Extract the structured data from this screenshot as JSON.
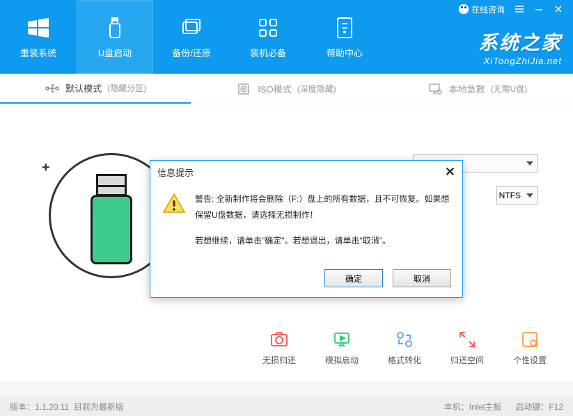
{
  "titlebar": {
    "consult": "在线咨询"
  },
  "nav": {
    "items": [
      {
        "label": "重装系统"
      },
      {
        "label": "U盘启动"
      },
      {
        "label": "备份/还原"
      },
      {
        "label": "装机必备"
      },
      {
        "label": "帮助中心"
      }
    ]
  },
  "brand": {
    "main": "系统之家",
    "sub": "XiTongZhiJia.net"
  },
  "modes": {
    "items": [
      {
        "label": "默认模式",
        "sub": "(隐藏分区)"
      },
      {
        "label": "ISO模式",
        "sub": "(深度隐藏)"
      },
      {
        "label": "本地急救",
        "sub": "(无需U盘)"
      }
    ]
  },
  "fields": {
    "filesystem": "NTFS"
  },
  "tools": {
    "items": [
      {
        "label": "无损归还",
        "color": "#ff4c4c"
      },
      {
        "label": "模拟启动",
        "color": "#2ecc71"
      },
      {
        "label": "格式转化",
        "color": "#4a9eff"
      },
      {
        "label": "归还空间",
        "color": "#ff4c4c"
      },
      {
        "label": "个性设置",
        "color": "#ff9a3c"
      }
    ]
  },
  "status": {
    "version_label": "版本：",
    "version": "1.1.20.11",
    "latest": "目前为最新版",
    "host_label": "本机：",
    "host": "Intel主板",
    "bootkey_label": "启动键：",
    "bootkey": "F12"
  },
  "dialog": {
    "title": "信息提示",
    "warn_line1": "警告: 全新制作将会删除（F:）盘上的所有数据，且不可恢复。如果想保留U盘数据，请选择无损制作！",
    "warn_line2": "若想继续，请单击\"确定\"。若想退出，请单击\"取消\"。",
    "ok": "确定",
    "cancel": "取消"
  }
}
